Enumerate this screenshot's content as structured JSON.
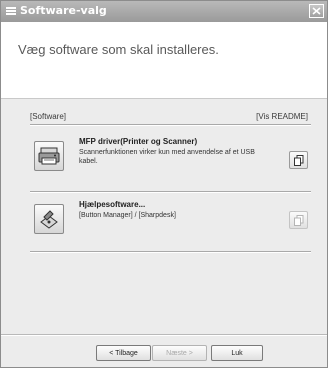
{
  "window": {
    "title": "Software-valg"
  },
  "header": {
    "heading": "Væg software som skal installeres."
  },
  "columns": {
    "left": "[Software]",
    "right": "[Vis README]"
  },
  "items": [
    {
      "title": "MFP driver(Printer og Scanner)",
      "description": "Scannerfunktionen virker kun med anvendelse af et USB kabel.",
      "readme_enabled": true
    },
    {
      "title": "Hjælpesoftware...",
      "description": "[Button Manager] / [Sharpdesk]",
      "readme_enabled": false
    }
  ],
  "footer": {
    "back_label": "< Tilbage",
    "next_label": "Næste >",
    "close_label": "Luk"
  }
}
